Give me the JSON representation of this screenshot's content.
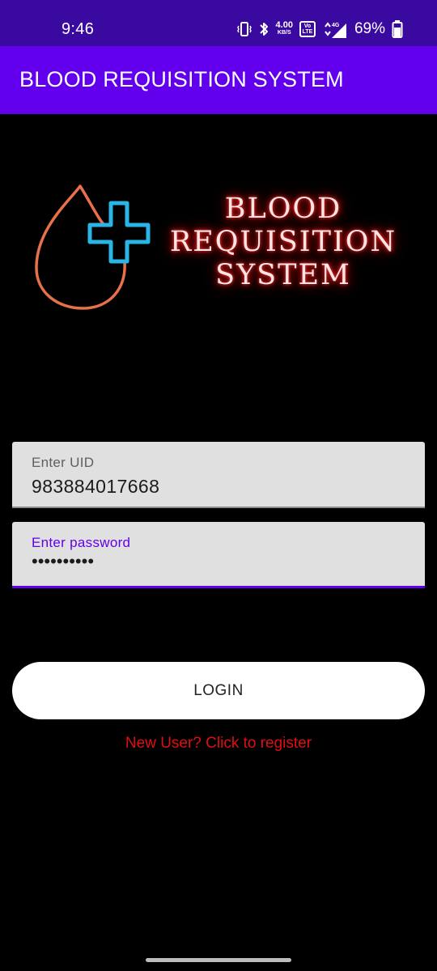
{
  "status_bar": {
    "time": "9:46",
    "icons": [
      "vibrate-icon",
      "bluetooth-icon",
      "network-speed",
      "volte-icon",
      "signal-icon",
      "battery-icon"
    ],
    "network_speed_value": "4.00",
    "network_speed_unit": "KB/S",
    "volte_label": "Vo LTE",
    "signal_label": "4G",
    "battery_percent": "69%"
  },
  "app_bar": {
    "title": "BLOOD REQUISITION SYSTEM"
  },
  "logo": {
    "line1": "BLOOD",
    "line2": "REQUISITION",
    "line3": "SYSTEM",
    "drop_color": "#e8704a",
    "cross_color": "#29b6e6",
    "glow_color": "#e00000"
  },
  "form": {
    "uid_label": "Enter UID",
    "uid_value": "983884017668",
    "password_label": "Enter password",
    "password_value": "••••••••••",
    "login_label": "LOGIN",
    "register_link": "New User? Click to register"
  },
  "colors": {
    "status_bar": "#3a0aa0",
    "primary": "#6200ee",
    "background": "#000000",
    "link": "#e20e0e"
  }
}
